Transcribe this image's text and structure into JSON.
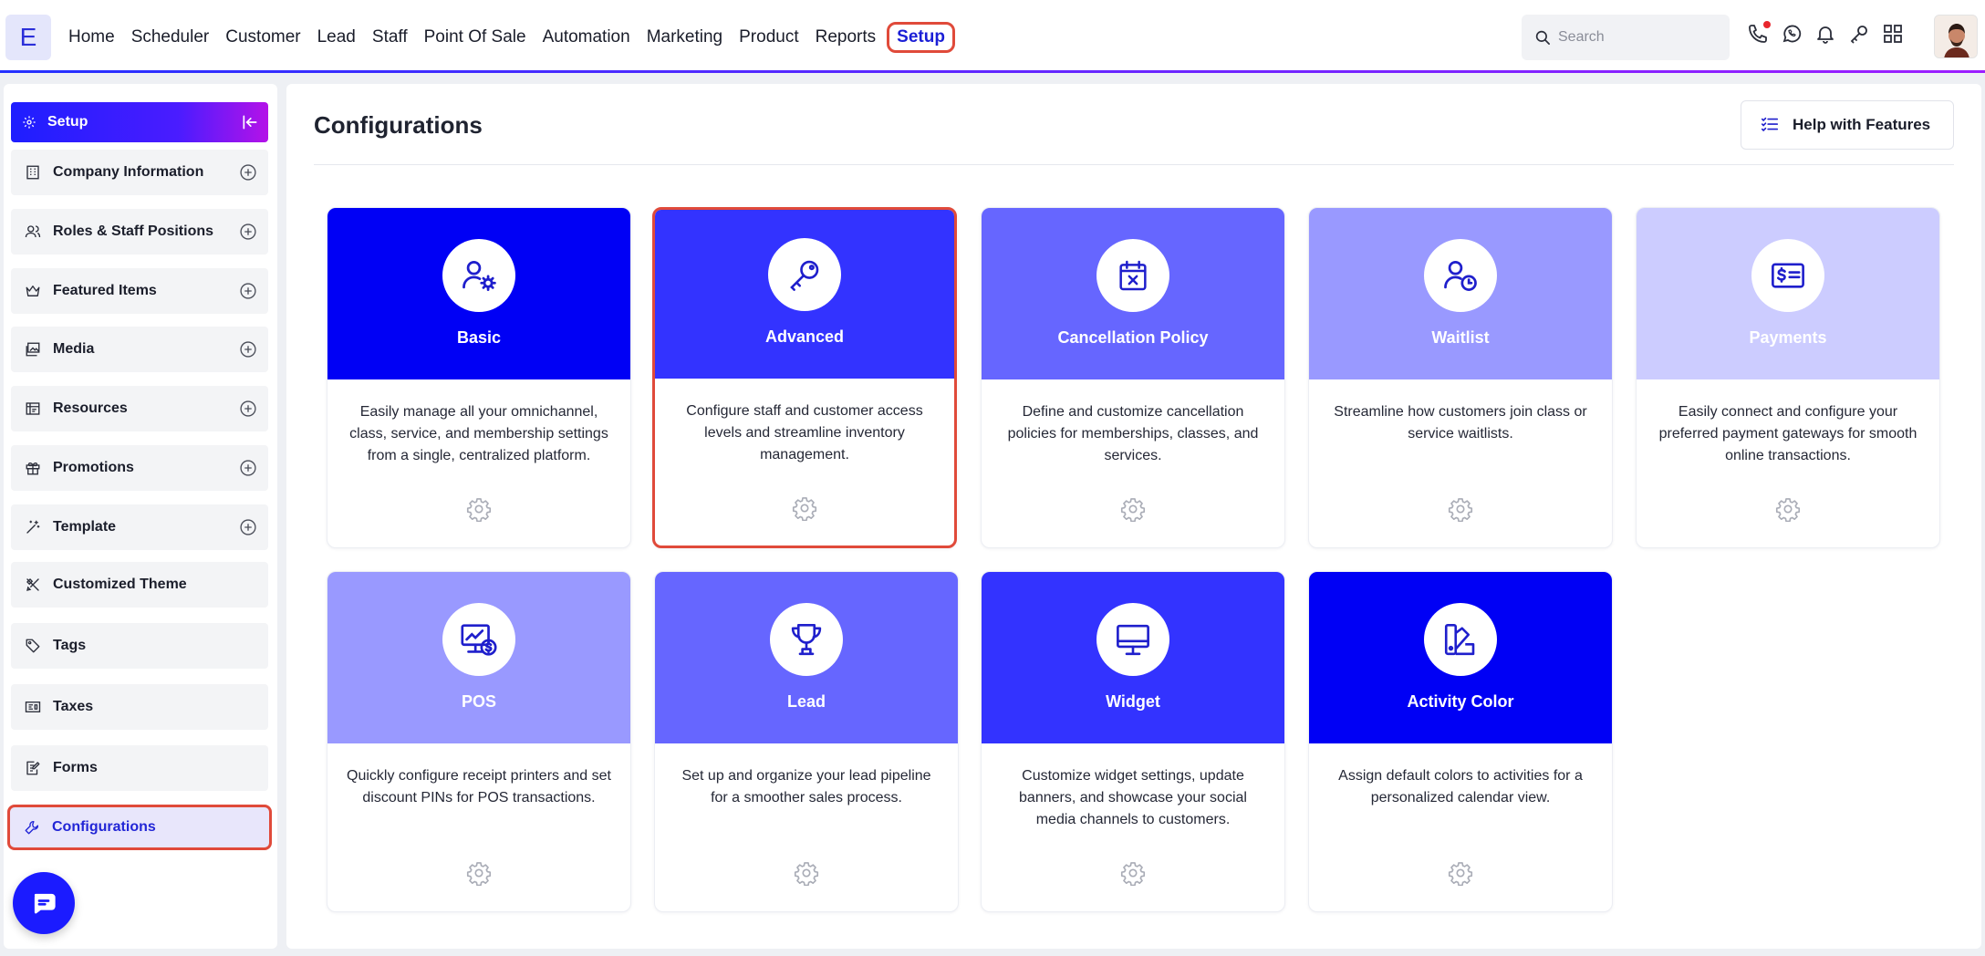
{
  "app": {
    "logo_letter": "E"
  },
  "nav": {
    "items": [
      "Home",
      "Scheduler",
      "Customer",
      "Lead",
      "Staff",
      "Point Of Sale",
      "Automation",
      "Marketing",
      "Product",
      "Reports"
    ],
    "active": "Setup"
  },
  "search": {
    "placeholder": "Search"
  },
  "toolbar_icons": [
    "phone-icon",
    "whatsapp-icon",
    "bell-icon",
    "key-icon",
    "apps-grid-icon"
  ],
  "sidebar": {
    "header": "Setup",
    "items": [
      {
        "label": "Company Information",
        "icon": "building-icon",
        "expandable": true
      },
      {
        "label": "Roles & Staff Positions",
        "icon": "users-icon",
        "expandable": true
      },
      {
        "label": "Featured Items",
        "icon": "crown-icon",
        "expandable": true
      },
      {
        "label": "Media",
        "icon": "images-icon",
        "expandable": true
      },
      {
        "label": "Resources",
        "icon": "resources-icon",
        "expandable": true
      },
      {
        "label": "Promotions",
        "icon": "gift-icon",
        "expandable": true
      },
      {
        "label": "Template",
        "icon": "magic-wand-icon",
        "expandable": true
      },
      {
        "label": "Customized Theme",
        "icon": "theme-icon",
        "expandable": false
      },
      {
        "label": "Tags",
        "icon": "tag-icon",
        "expandable": false
      },
      {
        "label": "Taxes",
        "icon": "tax-icon",
        "expandable": false
      },
      {
        "label": "Forms",
        "icon": "form-icon",
        "expandable": false
      },
      {
        "label": "Configurations",
        "icon": "wrench-icon",
        "expandable": false,
        "active": true
      }
    ]
  },
  "main": {
    "title": "Configurations",
    "help_button": "Help with Features",
    "cards": [
      {
        "title": "Basic",
        "description": "Easily manage all your omnichannel, class, service, and membership settings from a single, centralized platform.",
        "color": "#0000f5",
        "icon": "user-settings-icon"
      },
      {
        "title": "Advanced",
        "description": "Configure staff and customer access levels and streamline inventory management.",
        "color": "#3333ff",
        "icon": "key-icon",
        "selected": true
      },
      {
        "title": "Cancellation Policy",
        "description": "Define and customize cancellation policies for memberships, classes, and services.",
        "color": "#6666ff",
        "icon": "calendar-x-icon"
      },
      {
        "title": "Waitlist",
        "description": "Streamline how customers join class or service waitlists.",
        "color": "#9999ff",
        "icon": "user-clock-icon"
      },
      {
        "title": "Payments",
        "description": "Easily connect and configure your preferred payment gateways for smooth online transactions.",
        "color": "#ccccff",
        "icon": "money-card-icon"
      },
      {
        "title": "POS",
        "description": "Quickly configure receipt printers and set discount PINs for POS transactions.",
        "color": "#9999ff",
        "icon": "pos-chart-icon"
      },
      {
        "title": "Lead",
        "description": "Set up and organize your lead pipeline for a smoother sales process.",
        "color": "#6666ff",
        "icon": "trophy-icon"
      },
      {
        "title": "Widget",
        "description": "Customize widget settings, update banners, and showcase your social media channels to customers.",
        "color": "#3333ff",
        "icon": "monitor-icon"
      },
      {
        "title": "Activity Color",
        "description": "Assign default colors to activities for a personalized calendar view.",
        "color": "#0000f5",
        "icon": "palette-icon"
      }
    ]
  },
  "colors": {
    "accent": "#1b1fd6",
    "highlight_border": "#e04a3a",
    "icon_stroke": "#1f1fcc"
  }
}
